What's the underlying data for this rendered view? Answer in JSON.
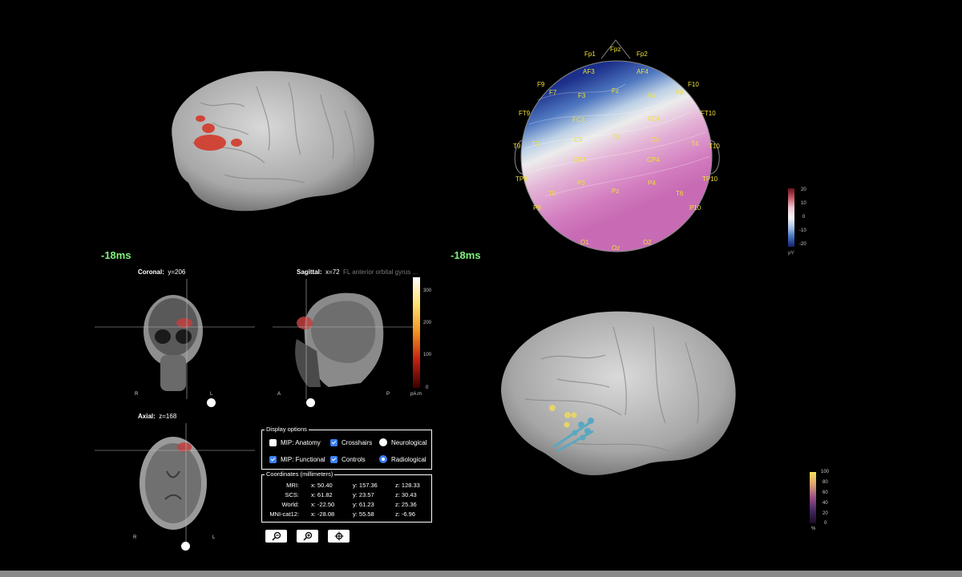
{
  "time_left": "-18ms",
  "time_right": "-18ms",
  "mri": {
    "coronal": {
      "title": "Coronal:",
      "value": "y=206",
      "left_label": "R",
      "right_label": "L"
    },
    "sagittal": {
      "title": "Sagittal:",
      "value": "x=72",
      "region": "FL anterior orbital gyrus ...",
      "left_label": "A",
      "right_label": "P"
    },
    "axial": {
      "title": "Axial:",
      "value": "z=168",
      "left_label": "R",
      "right_label": "L"
    },
    "colorbar": {
      "ticks": [
        "300",
        "200",
        "100",
        "0"
      ],
      "unit": "pA.m"
    }
  },
  "display_options": {
    "legend": "Display options",
    "mip_anatomy": {
      "label": "MIP: Anatomy",
      "checked": false
    },
    "crosshairs": {
      "label": "Crosshairs",
      "checked": true
    },
    "neurological": {
      "label": "Neurological",
      "selected": false
    },
    "mip_functional": {
      "label": "MIP: Functional",
      "checked": true
    },
    "controls": {
      "label": "Controls",
      "checked": true
    },
    "radiological": {
      "label": "Radiological",
      "selected": true
    }
  },
  "coordinates": {
    "legend": "Coordinates (millimeters)",
    "rows": [
      {
        "label": "MRI:",
        "x": "x: 50.40",
        "y": "y: 157.36",
        "z": "z: 128.33"
      },
      {
        "label": "SCS:",
        "x": "x: 61.82",
        "y": "y: 23.57",
        "z": "z: 30.43"
      },
      {
        "label": "World:",
        "x": "x: -22.50",
        "y": "y: 61.23",
        "z": "z: 25.36"
      },
      {
        "label": "MNI-cat12:",
        "x": "x: -28.08",
        "y": "y: 55.58",
        "z": "z: -6.96"
      }
    ]
  },
  "toolbar": {
    "zoom_out": "zoom-out-icon",
    "zoom_in": "zoom-in-icon",
    "crosshair": "crosshair-icon"
  },
  "topo": {
    "electrodes": [
      "Fp1",
      "Fpz",
      "Fp2",
      "AF3",
      "AF4",
      "F9",
      "F7",
      "F3",
      "Fz",
      "F4",
      "F8",
      "F10",
      "FT9",
      "FC3",
      "FC4",
      "FT10",
      "T9",
      "T3",
      "C3",
      "Cz",
      "C4",
      "T4",
      "T10",
      "CP3",
      "CP4",
      "TP9",
      "P3",
      "Pz",
      "P4",
      "TP10",
      "T5",
      "T6",
      "P9",
      "P10",
      "O1",
      "Oz",
      "O2"
    ],
    "colorbar": {
      "ticks": [
        "20",
        "10",
        "0",
        "-10",
        "-20"
      ],
      "unit": "μV"
    }
  },
  "surface_colorbar": {
    "ticks": [
      "100",
      "80",
      "60",
      "40",
      "20",
      "0"
    ],
    "unit": "%"
  },
  "colors": {
    "accent_green": "#7ff07a",
    "electrode_yellow": "#f0e030",
    "check_blue": "#3b82f6"
  }
}
